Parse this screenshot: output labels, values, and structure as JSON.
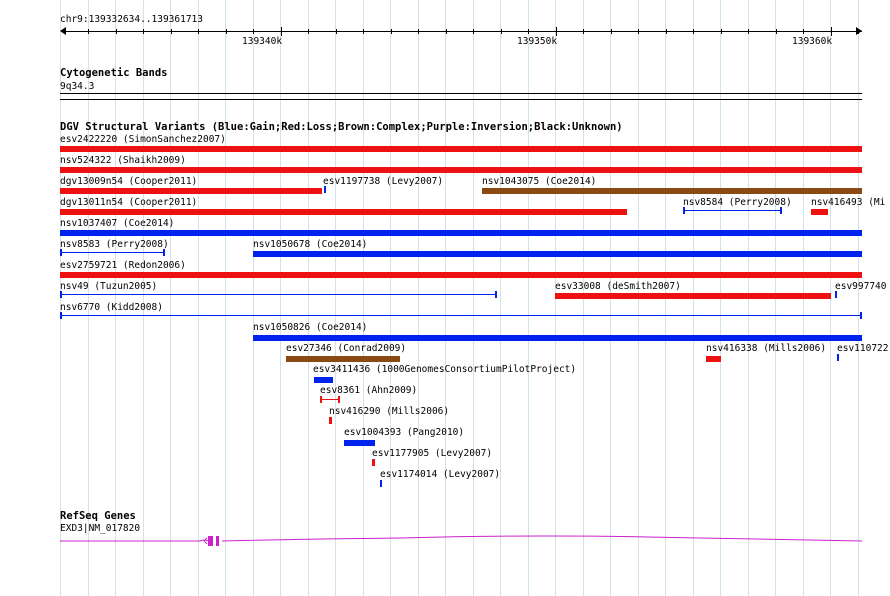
{
  "ruler": {
    "location": "chr9:139332634..139361713",
    "ticks": [
      "139340k",
      "139350k",
      "139360k"
    ]
  },
  "tracks": {
    "cyto": {
      "title": "Cytogenetic Bands",
      "band": "9q34.3"
    },
    "dgv": {
      "title": "DGV Structural Variants (Blue:Gain;Red:Loss;Brown:Complex;Purple:Inversion;Black:Unknown)"
    },
    "refseq": {
      "title": "RefSeq Genes",
      "gene": "EXD3|NM_017820"
    }
  },
  "colors": {
    "gain": "#0022ee",
    "loss": "#ee1111",
    "complex": "#8b4a14",
    "gene": "#cc22cc",
    "grid": "#cfe3ee"
  },
  "features": [
    {
      "label": "esv2422220 (SimonSanchez2007)",
      "type": "loss",
      "style": "bar"
    },
    {
      "label": "nsv524322 (Shaikh2009)",
      "type": "loss",
      "style": "bar"
    },
    {
      "label": "dgv13009n54 (Cooper2011)",
      "type": "loss",
      "style": "bar"
    },
    {
      "label": "esv1197738 (Levy2007)",
      "type": "gain",
      "style": "tick"
    },
    {
      "label": "nsv1043075 (Coe2014)",
      "type": "complex",
      "style": "bar"
    },
    {
      "label": "dgv13011n54 (Cooper2011)",
      "type": "loss",
      "style": "bar"
    },
    {
      "label": "nsv8584 (Perry2008)",
      "type": "gain",
      "style": "thin"
    },
    {
      "label": "nsv416493 (Mi",
      "type": "loss",
      "style": "bar"
    },
    {
      "label": "nsv1037407 (Coe2014)",
      "type": "gain",
      "style": "bar"
    },
    {
      "label": "nsv8583 (Perry2008)",
      "type": "gain",
      "style": "thin"
    },
    {
      "label": "nsv1050678 (Coe2014)",
      "type": "gain",
      "style": "bar"
    },
    {
      "label": "esv2759721 (Redon2006)",
      "type": "loss",
      "style": "bar"
    },
    {
      "label": "nsv49 (Tuzun2005)",
      "type": "gain",
      "style": "thin"
    },
    {
      "label": "esv33008 (deSmith2007)",
      "type": "loss",
      "style": "bar"
    },
    {
      "label": "esv997740",
      "type": "gain",
      "style": "tick"
    },
    {
      "label": "nsv6770 (Kidd2008)",
      "type": "gain",
      "style": "thin"
    },
    {
      "label": "nsv1050826 (Coe2014)",
      "type": "gain",
      "style": "bar"
    },
    {
      "label": "esv27346 (Conrad2009)",
      "type": "complex",
      "style": "bar"
    },
    {
      "label": "nsv416338 (Mills2006)",
      "type": "loss",
      "style": "bar"
    },
    {
      "label": "esv110722",
      "type": "gain",
      "style": "tick"
    },
    {
      "label": "esv3411436 (1000GenomesConsortiumPilotProject)",
      "type": "gain",
      "style": "bar"
    },
    {
      "label": "esv8361 (Ahn2009)",
      "type": "loss",
      "style": "thin"
    },
    {
      "label": "nsv416290 (Mills2006)",
      "type": "loss",
      "style": "tick"
    },
    {
      "label": "esv1004393 (Pang2010)",
      "type": "gain",
      "style": "bar"
    },
    {
      "label": "esv1177905 (Levy2007)",
      "type": "loss",
      "style": "tick"
    },
    {
      "label": "esv1174014 (Levy2007)",
      "type": "gain",
      "style": "tick"
    }
  ]
}
